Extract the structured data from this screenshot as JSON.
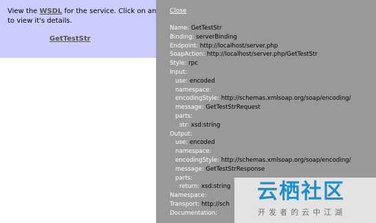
{
  "intro": {
    "prefix": "View the ",
    "wsdl_link": "WSDL",
    "suffix": " for the service. Click on an o",
    "line2": "to view it's details."
  },
  "operations": [
    {
      "label": "GetTestStr"
    }
  ],
  "overlay": {
    "close_label": "Close",
    "details": [
      {
        "key": "Name: ",
        "value": "GetTestStr",
        "indent": 0
      },
      {
        "key": "Binding: ",
        "value": "serverBinding",
        "indent": 0
      },
      {
        "key": "Endpoint: ",
        "value": "http://localhost/server.php",
        "indent": 0
      },
      {
        "key": "SoapAction: ",
        "value": "http://localhost/server.php/GetTestStr",
        "indent": 0
      },
      {
        "key": "Style: ",
        "value": "rpc",
        "indent": 0
      },
      {
        "key": "Input:",
        "value": "",
        "indent": 0
      },
      {
        "key": "use: ",
        "value": "encoded",
        "indent": 1
      },
      {
        "key": "namespace: ",
        "value": "",
        "indent": 1
      },
      {
        "key": "encodingStyle: ",
        "value": "http://schemas.xmlsoap.org/soap/encoding/",
        "indent": 1
      },
      {
        "key": "message: ",
        "value": "GetTestStrRequest",
        "indent": 1
      },
      {
        "key": "parts:",
        "value": "",
        "indent": 1
      },
      {
        "key": "str: ",
        "value": "xsd:string",
        "indent": 2
      },
      {
        "key": "Output:",
        "value": "",
        "indent": 0
      },
      {
        "key": "use: ",
        "value": "encoded",
        "indent": 1
      },
      {
        "key": "namespace: ",
        "value": "",
        "indent": 1
      },
      {
        "key": "encodingStyle: ",
        "value": "http://schemas.xmlsoap.org/soap/encoding/",
        "indent": 1
      },
      {
        "key": "message: ",
        "value": "GetTestStrResponse",
        "indent": 1
      },
      {
        "key": "parts:",
        "value": "",
        "indent": 1
      },
      {
        "key": "return: ",
        "value": "xsd:string",
        "indent": 2
      },
      {
        "key": "Namespace: ",
        "value": "",
        "indent": 0
      },
      {
        "key": "Transport: ",
        "value": "http://sch",
        "indent": 0
      },
      {
        "key": "Documentation: ",
        "value": "",
        "indent": 0
      }
    ]
  },
  "watermark": {
    "title": "云栖社区",
    "subtitle": "开发者的云中江湖"
  },
  "colors": {
    "left_panel_bg": "#ccccff",
    "overlay_bg": "#999999",
    "link_color": "#555555",
    "watermark_blue": "#1f8ec9"
  }
}
